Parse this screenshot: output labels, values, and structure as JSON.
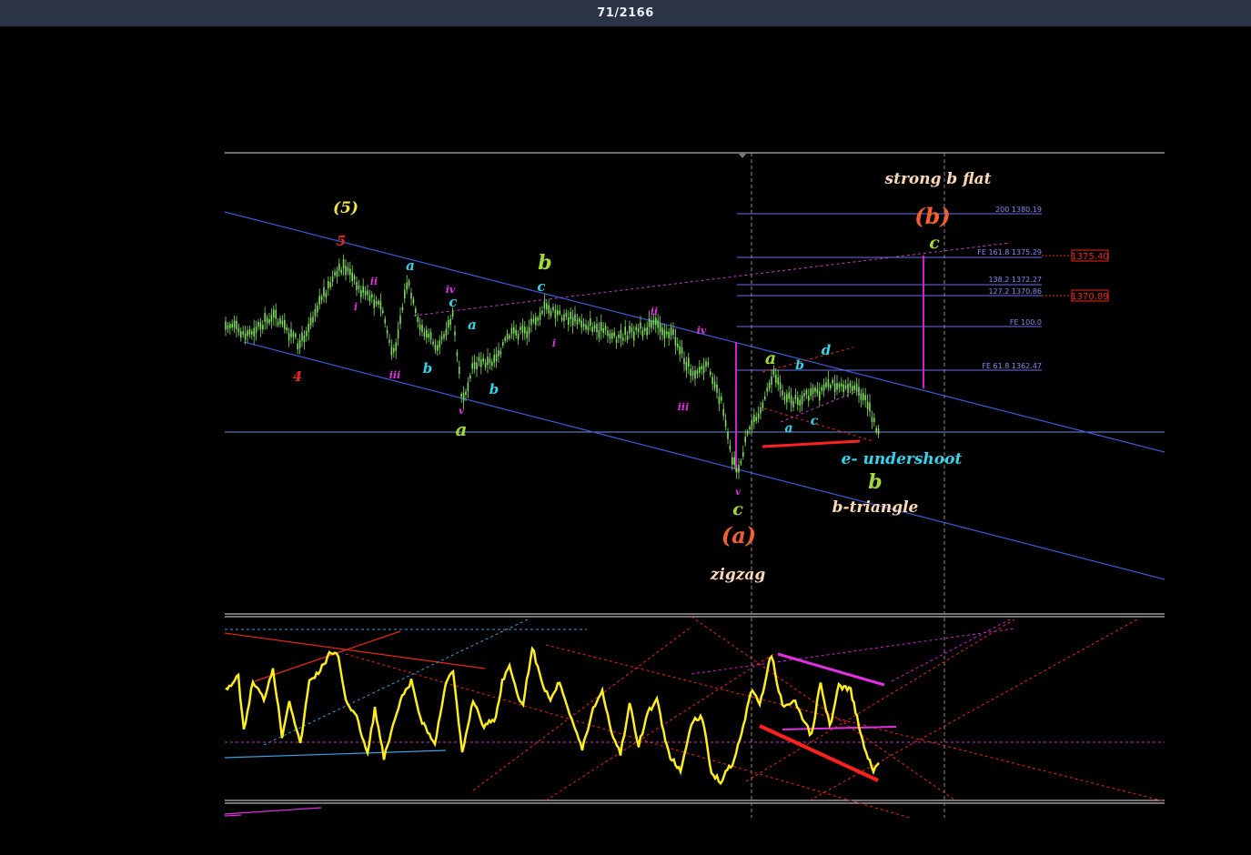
{
  "window": {
    "frame_counter": "71/2166"
  },
  "colors": {
    "price_bar": "#7fdc5a",
    "channel": "#3a5bd8",
    "oscillator": "#ffee22",
    "wave_yellow": "#f2e34c",
    "wave_red": "#e8281a",
    "wave_magenta": "#e030e0",
    "wave_cyan": "#35d4ec",
    "wave_green": "#a2d83a",
    "wave_peach": "#ffd8b4",
    "fib_line": "#6e6ee8",
    "price_tag": "#e8281a"
  },
  "price_labels": [
    "1375.40",
    "1370.89"
  ],
  "fib_levels": [
    {
      "label": "200 1380.19"
    },
    {
      "label": "FE 161.8 1375.29"
    },
    {
      "label": "138.2 1372.27"
    },
    {
      "label": "127.2 1370.86"
    },
    {
      "label": "FE 100.0"
    },
    {
      "label": "FE 61.8 1362.47"
    }
  ],
  "wave_labels": {
    "w5_paren": "(5)",
    "w5": "5",
    "w4": "4",
    "a_top": "a",
    "ii_1": "ii",
    "i_1": "i",
    "iii_1": "iii",
    "b_1": "b",
    "iv_1": "iv",
    "c_1": "c",
    "v_1": "v",
    "a_1": "a",
    "a_green1": "a",
    "b_2": "b",
    "b_green1": "b",
    "c_2": "c",
    "i_2": "i",
    "ii_2": "ii",
    "iv_2": "iv",
    "iii_2": "iii",
    "a_green2": "a",
    "b_3": "b",
    "d": "d",
    "a_2": "a",
    "c_3": "c",
    "v_2": "v",
    "c_green1": "c",
    "a_paren": "(a)",
    "zigzag": "zigzag",
    "e_undershoot": "e- undershoot",
    "b_green2": "b",
    "b_triangle": "b-triangle",
    "strong_b_flat": "strong b flat",
    "b_paren": "(b)",
    "c_green2": "c"
  }
}
